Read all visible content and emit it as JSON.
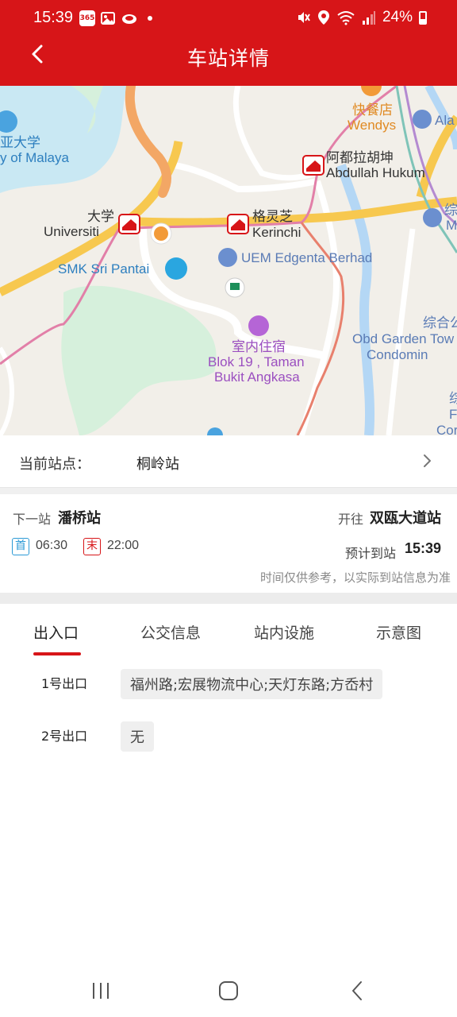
{
  "status_bar": {
    "time": "15:39",
    "battery": "24%",
    "icons": [
      "calendar-365-icon",
      "gallery-icon",
      "cloud-icon",
      "dot-icon",
      "mute-icon",
      "location-icon",
      "wifi-icon",
      "signal-icon",
      "battery-icon"
    ]
  },
  "header": {
    "title": "车站详情",
    "background": "#d71518"
  },
  "map": {
    "labels": {
      "univ_cn": "亚大学",
      "univ_en": "y of Malaya",
      "wendys_cn": "快餐店",
      "wendys_en": "Wendys",
      "ala": "Ala",
      "abdullah_cn": "阿都拉胡坤",
      "abdullah_en": "Abdullah Hukum",
      "daxue_cn": "大学",
      "daxue_en": "Universiti",
      "kerinchi_cn": "格灵芝",
      "kerinchi_en": "Kerinchi",
      "zong_cn": "综",
      "zong_m": "M",
      "smk": "SMK Sri Pantai",
      "uem": "UEM Edgenta Berhad",
      "zonghe": "综合公",
      "obd1": "Obd Garden Tow",
      "obd2": "Condomin",
      "stay_cn": "室内住宿",
      "stay_en1": "Blok 19 , Taman",
      "stay_en2": "Bukit Angkasa",
      "edge_f": "F",
      "edge_cor": "Cor",
      "edge_zong2": "综"
    }
  },
  "current_station": {
    "label": "当前站点：",
    "value": "桐岭站"
  },
  "next_info": {
    "next_label": "下一站",
    "next_station": "潘桥站",
    "toward_label": "开往",
    "toward_station": "双瓯大道站",
    "first_badge": "首",
    "first_time": "06:30",
    "last_badge": "末",
    "last_time": "22:00",
    "arrive_label": "预计到站",
    "arrive_time": "15:39",
    "note": "时间仅供参考，以实际到站信息为准"
  },
  "tabs": [
    {
      "label": "出入口",
      "active": true
    },
    {
      "label": "公交信息",
      "active": false
    },
    {
      "label": "站内设施",
      "active": false
    },
    {
      "label": "示意图",
      "active": false
    }
  ],
  "exits": [
    {
      "name": "1号出口",
      "detail": "福州路;宏展物流中心;天灯东路;方岙村"
    },
    {
      "name": "2号出口",
      "detail": "无"
    }
  ],
  "colors": {
    "accent": "#d71518",
    "first_badge": "#2c9ad6"
  }
}
